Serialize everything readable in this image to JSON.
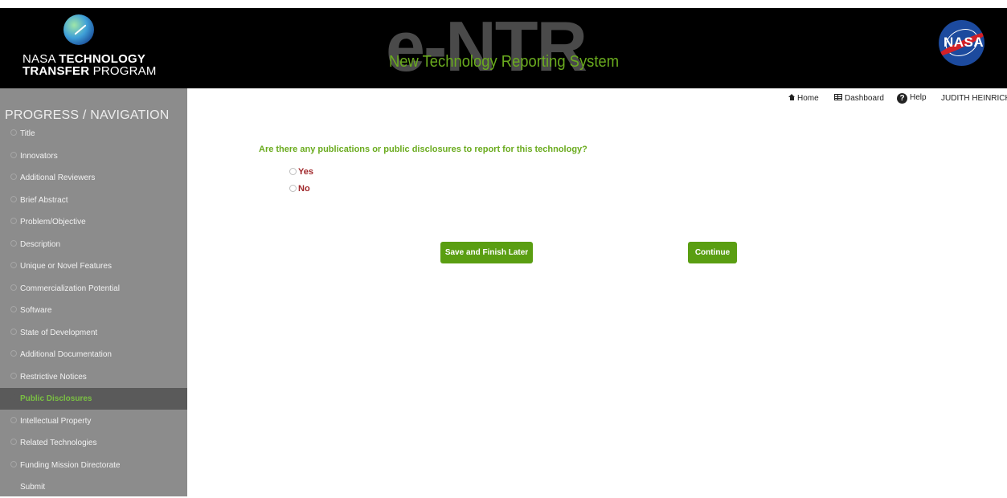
{
  "header": {
    "logo_line1_light": "NASA ",
    "logo_line1_bold": "TECHNOLOGY",
    "logo_line2_bold": "TRANSFER",
    "logo_line2_light": " PROGRAM",
    "brand_big": "e-NTR",
    "brand_sub": "New Technology Reporting System",
    "nasa_word": "NASA"
  },
  "topnav": {
    "home": "Home",
    "dashboard": "Dashboard",
    "help": "Help",
    "help_glyph": "?",
    "user": "JUDITH HEINRICH"
  },
  "sidebar": {
    "title": "PROGRESS / NAVIGATION",
    "items": [
      {
        "label": "Title"
      },
      {
        "label": "Innovators"
      },
      {
        "label": "Additional Reviewers"
      },
      {
        "label": "Brief Abstract"
      },
      {
        "label": "Problem/Objective"
      },
      {
        "label": "Description"
      },
      {
        "label": "Unique or Novel Features"
      },
      {
        "label": "Commercialization Potential"
      },
      {
        "label": "Software"
      },
      {
        "label": "State of Development"
      },
      {
        "label": "Additional Documentation"
      },
      {
        "label": "Restrictive Notices"
      },
      {
        "label": "Public Disclosures",
        "active": true
      },
      {
        "label": "Intellectual Property"
      },
      {
        "label": "Related Technologies"
      },
      {
        "label": "Funding Mission Directorate"
      },
      {
        "label": "Submit"
      }
    ]
  },
  "main": {
    "question": "Are there any publications or public disclosures to report for this technology?",
    "options": [
      "Yes",
      "No"
    ],
    "selected": null,
    "save_label": "Save and Finish Later",
    "continue_label": "Continue"
  },
  "colors": {
    "accent_green": "#6aab1e",
    "button_green": "#5a9e12",
    "option_red": "#a0282b",
    "sidebar_bg": "#8c8c8c",
    "sidebar_active_bg": "#5a5a5a",
    "header_bg": "#000000"
  }
}
